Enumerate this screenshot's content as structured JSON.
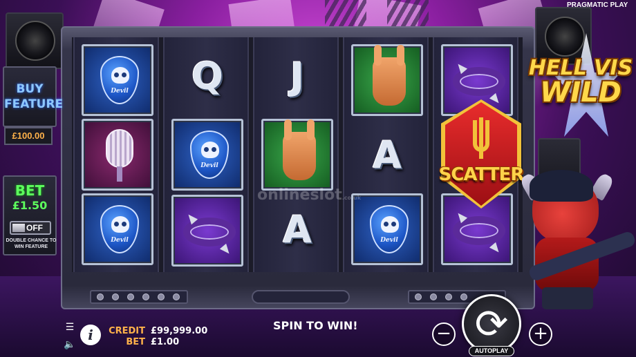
{
  "provider": "PRAGMATIC PLAY",
  "game_logo": {
    "line1": "HELL VIS",
    "line2": "WILD"
  },
  "left_panel": {
    "buy_feature_line1": "BUY",
    "buy_feature_line2": "FEATURE",
    "buy_price": "£100.00",
    "bet_label": "BET",
    "bet_value": "£1.50",
    "toggle_state": "OFF",
    "double_chance_text": "DOUBLE CHANCE TO WIN FEATURE"
  },
  "reels": [
    [
      "blue-devil-pick",
      "maroon-microphone",
      "blue-devil-pick"
    ],
    [
      "Q",
      "blue-devil-pick",
      "purple-spiked-bracelet"
    ],
    [
      "J",
      "green-rock-hand",
      "A"
    ],
    [
      "green-rock-hand",
      "A",
      "blue-devil-pick"
    ],
    [
      "purple-spiked-bracelet",
      "SCATTER",
      "purple-spiked-bracelet"
    ]
  ],
  "letters": {
    "q": "Q",
    "j": "J",
    "a1": "A",
    "a2": "A"
  },
  "devil_pick_text": "Devil",
  "scatter_label": "SCATTER",
  "watermark": {
    "main": "onlineslot",
    "tld": ".co.uk"
  },
  "bottom_bar": {
    "credit_label": "CREDIT",
    "credit_value": "£99,999.00",
    "bet_label": "BET",
    "bet_value": "£1.00",
    "message": "SPIN TO WIN!",
    "minus_label": "−",
    "plus_label": "+",
    "autoplay_label": "AUTOPLAY",
    "info_label": "i"
  },
  "icons": {
    "menu": "menu-icon",
    "sound": "sound-icon",
    "spin": "spin-icon"
  },
  "colors": {
    "accent_orange": "#ffb24a",
    "bet_green": "#5dff5d",
    "buy_blue": "#8ec8ff",
    "scatter_gold": "#ffd34a"
  }
}
